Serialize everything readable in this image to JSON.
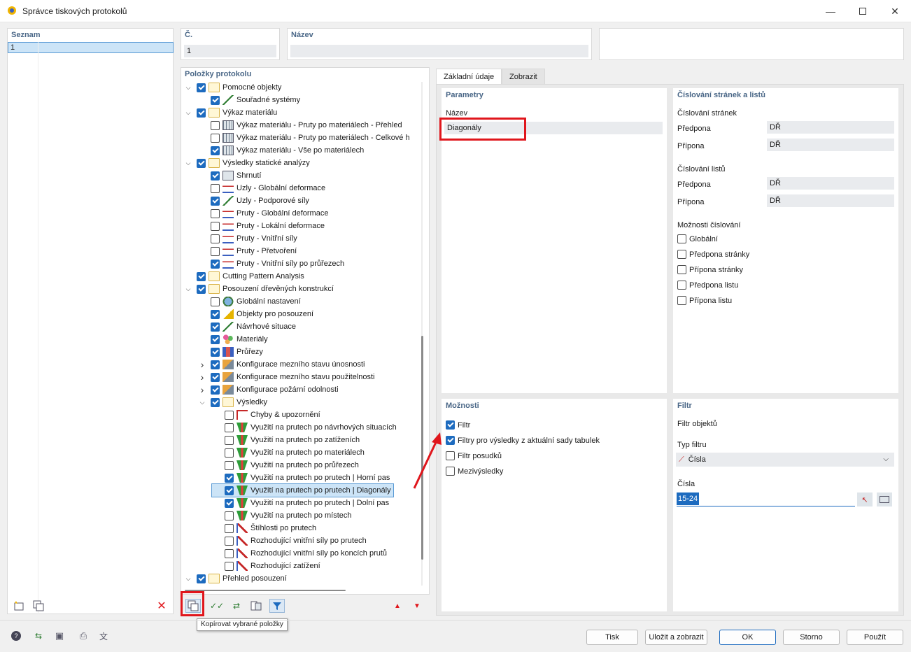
{
  "window": {
    "title": "Správce tiskových protokolů"
  },
  "list": {
    "header": "Seznam",
    "items": [
      "1"
    ]
  },
  "number": {
    "label": "Č.",
    "value": "1"
  },
  "name": {
    "label": "Název",
    "value": ""
  },
  "tree": {
    "header": "Položky protokolu",
    "rows": [
      {
        "level": 0,
        "chev": "v",
        "checked": true,
        "icon": "folder",
        "label": "Pomocné objekty"
      },
      {
        "level": 1,
        "chev": "",
        "checked": true,
        "icon": "axes",
        "label": "Souřadné systémy"
      },
      {
        "level": 0,
        "chev": "v",
        "checked": true,
        "icon": "folder",
        "label": "Výkaz materiálu"
      },
      {
        "level": 1,
        "chev": "",
        "checked": false,
        "icon": "grid",
        "label": "Výkaz materiálu - Pruty po materiálech - Přehled"
      },
      {
        "level": 1,
        "chev": "",
        "checked": false,
        "icon": "grid",
        "label": "Výkaz materiálu - Pruty po materiálech - Celkové h"
      },
      {
        "level": 1,
        "chev": "",
        "checked": true,
        "icon": "grid",
        "label": "Výkaz materiálu - Vše po materiálech"
      },
      {
        "level": 0,
        "chev": "v",
        "checked": true,
        "icon": "folder",
        "label": "Výsledky statické analýzy"
      },
      {
        "level": 1,
        "chev": "",
        "checked": true,
        "icon": "sum",
        "label": "Shrnutí"
      },
      {
        "level": 1,
        "chev": "",
        "checked": false,
        "icon": "res",
        "label": "Uzly - Globální deformace"
      },
      {
        "level": 1,
        "chev": "",
        "checked": true,
        "icon": "axes",
        "label": "Uzly - Podporové síly"
      },
      {
        "level": 1,
        "chev": "",
        "checked": false,
        "icon": "res",
        "label": "Pruty - Globální deformace"
      },
      {
        "level": 1,
        "chev": "",
        "checked": false,
        "icon": "res",
        "label": "Pruty - Lokální deformace"
      },
      {
        "level": 1,
        "chev": "",
        "checked": false,
        "icon": "res",
        "label": "Pruty - Vnitřní síly"
      },
      {
        "level": 1,
        "chev": "",
        "checked": false,
        "icon": "res",
        "label": "Pruty - Přetvoření"
      },
      {
        "level": 1,
        "chev": "",
        "checked": true,
        "icon": "res",
        "label": "Pruty - Vnitřní síly po průřezech"
      },
      {
        "level": 0,
        "chev": "",
        "checked": true,
        "icon": "folder",
        "label": "Cutting Pattern Analysis"
      },
      {
        "level": 0,
        "chev": "v",
        "checked": true,
        "icon": "folder",
        "label": "Posouzení dřevěných konstrukcí"
      },
      {
        "level": 1,
        "chev": "",
        "checked": false,
        "icon": "globe",
        "label": "Globální nastavení"
      },
      {
        "level": 1,
        "chev": "",
        "checked": true,
        "icon": "tri",
        "label": "Objekty pro posouzení"
      },
      {
        "level": 1,
        "chev": "",
        "checked": true,
        "icon": "axes",
        "label": "Návrhové situace"
      },
      {
        "level": 1,
        "chev": "",
        "checked": true,
        "icon": "mat",
        "label": "Materiály"
      },
      {
        "level": 1,
        "chev": "",
        "checked": true,
        "icon": "sect",
        "label": "Průřezy"
      },
      {
        "level": 1,
        "chev": ">",
        "checked": true,
        "icon": "cfg",
        "label": "Konfigurace mezního stavu únosnosti"
      },
      {
        "level": 1,
        "chev": ">",
        "checked": true,
        "icon": "cfg",
        "label": "Konfigurace mezního stavu použitelnosti"
      },
      {
        "level": 1,
        "chev": ">",
        "checked": true,
        "icon": "cfg",
        "label": "Konfigurace požární odolnosti"
      },
      {
        "level": 1,
        "chev": "v",
        "checked": true,
        "icon": "folder",
        "label": "Výsledky"
      },
      {
        "level": 2,
        "chev": "",
        "checked": false,
        "icon": "err",
        "label": "Chyby & upozornění"
      },
      {
        "level": 2,
        "chev": "",
        "checked": false,
        "icon": "util",
        "label": "Využití na prutech po návrhových situacích"
      },
      {
        "level": 2,
        "chev": "",
        "checked": false,
        "icon": "util",
        "label": "Využití na prutech po zatíženích"
      },
      {
        "level": 2,
        "chev": "",
        "checked": false,
        "icon": "util",
        "label": "Využití na prutech po materiálech"
      },
      {
        "level": 2,
        "chev": "",
        "checked": false,
        "icon": "util",
        "label": "Využití na prutech po průřezech"
      },
      {
        "level": 2,
        "chev": "",
        "checked": true,
        "icon": "util",
        "label": "Využití na prutech po prutech | Horní pas"
      },
      {
        "level": 2,
        "chev": "",
        "checked": true,
        "icon": "util",
        "label": "Využití na prutech po prutech | Diagonály",
        "selected": true
      },
      {
        "level": 2,
        "chev": "",
        "checked": true,
        "icon": "util",
        "label": "Využití na prutech po prutech | Dolní pas"
      },
      {
        "level": 2,
        "chev": "",
        "checked": false,
        "icon": "util",
        "label": "Využití na prutech po místech"
      },
      {
        "level": 2,
        "chev": "",
        "checked": false,
        "icon": "slender",
        "label": "Štíhlosti po prutech"
      },
      {
        "level": 2,
        "chev": "",
        "checked": false,
        "icon": "slender",
        "label": "Rozhodující vnitřní síly po prutech"
      },
      {
        "level": 2,
        "chev": "",
        "checked": false,
        "icon": "slender",
        "label": "Rozhodující vnitřní síly po koncích prutů"
      },
      {
        "level": 2,
        "chev": "",
        "checked": false,
        "icon": "slender",
        "label": "Rozhodující zatížení"
      },
      {
        "level": 0,
        "chev": "v",
        "checked": true,
        "icon": "folder",
        "label": "Přehled posouzení"
      }
    ]
  },
  "tooltip": "Kopírovat vybrané položky",
  "tabs": [
    "Základní údaje",
    "Zobrazit"
  ],
  "params": {
    "header": "Parametry",
    "name_label": "Název",
    "name_value": "Diagonály"
  },
  "paging": {
    "header": "Číslování stránek a listů",
    "pages_label": "Číslování stránek",
    "sheets_label": "Číslování listů",
    "prefix_label": "Předpona",
    "suffix_label": "Přípona",
    "pages_prefix": "DŘ",
    "pages_suffix": "DŘ",
    "sheets_prefix": "DŘ",
    "sheets_suffix": "DŘ",
    "options_label": "Možnosti číslování",
    "options": [
      "Globální",
      "Předpona stránky",
      "Přípona stránky",
      "Předpona listu",
      "Přípona listu"
    ]
  },
  "options": {
    "header": "Možnosti",
    "items": [
      {
        "label": "Filtr",
        "checked": true
      },
      {
        "label": "Filtry pro výsledky z aktuální sady tabulek",
        "checked": true
      },
      {
        "label": "Filtr posudků",
        "checked": false
      },
      {
        "label": "Mezivýsledky",
        "checked": false
      }
    ]
  },
  "filter": {
    "header": "Filtr",
    "objects_label": "Filtr objektů",
    "type_label": "Typ filtru",
    "type_value": "Čísla",
    "numbers_label": "Čísla",
    "numbers_value": "15-24"
  },
  "buttons": {
    "print": "Tisk",
    "save_show": "Uložit a zobrazit",
    "ok": "OK",
    "cancel": "Storno",
    "apply": "Použít"
  },
  "colors": {
    "accent": "#1d6bbf",
    "highlight": "#e0161c",
    "header": "#4a6787"
  }
}
